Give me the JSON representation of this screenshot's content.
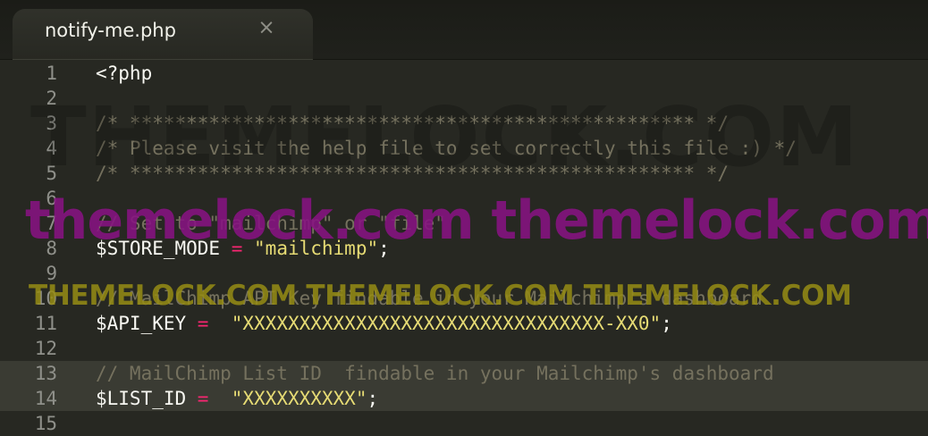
{
  "tab": {
    "title": "notify-me.php",
    "close_glyph": "×"
  },
  "lines": [
    {
      "num": "1",
      "tokens": [
        {
          "t": "<?php",
          "c": "pl"
        }
      ]
    },
    {
      "num": "2",
      "tokens": []
    },
    {
      "num": "3",
      "tokens": [
        {
          "t": "/* ************************************************** */",
          "c": "cm"
        }
      ]
    },
    {
      "num": "4",
      "tokens": [
        {
          "t": "/* Please visit the help file to set correctly this file :) */",
          "c": "cm"
        }
      ]
    },
    {
      "num": "5",
      "tokens": [
        {
          "t": "/* ************************************************** */",
          "c": "cm"
        }
      ]
    },
    {
      "num": "6",
      "tokens": []
    },
    {
      "num": "7",
      "tokens": [
        {
          "t": "// Set to \"mailchimp\" or \"file\"",
          "c": "cm"
        }
      ]
    },
    {
      "num": "8",
      "tokens": [
        {
          "t": "$STORE_MODE ",
          "c": "pl"
        },
        {
          "t": "=",
          "c": "op"
        },
        {
          "t": " ",
          "c": "pl"
        },
        {
          "t": "\"mailchimp\"",
          "c": "st"
        },
        {
          "t": ";",
          "c": "pl"
        }
      ]
    },
    {
      "num": "9",
      "tokens": []
    },
    {
      "num": "10",
      "tokens": [
        {
          "t": "// MailChimp API Key findable in your Mailchimp's dashboard",
          "c": "cm"
        }
      ]
    },
    {
      "num": "11",
      "tokens": [
        {
          "t": "$API_KEY ",
          "c": "pl"
        },
        {
          "t": "=",
          "c": "op"
        },
        {
          "t": "  ",
          "c": "pl"
        },
        {
          "t": "\"XXXXXXXXXXXXXXXXXXXXXXXXXXXXXXXX-XX0\"",
          "c": "st"
        },
        {
          "t": ";",
          "c": "pl"
        }
      ]
    },
    {
      "num": "12",
      "tokens": []
    },
    {
      "num": "13",
      "tokens": [
        {
          "t": "// MailChimp List ID  findable in your Mailchimp's dashboard",
          "c": "cm"
        }
      ],
      "active": true
    },
    {
      "num": "14",
      "tokens": [
        {
          "t": "$LIST_ID ",
          "c": "pl"
        },
        {
          "t": "=",
          "c": "op"
        },
        {
          "t": "  ",
          "c": "pl"
        },
        {
          "t": "\"XXXXXXXXXX\"",
          "c": "st"
        },
        {
          "t": ";",
          "c": "pl"
        }
      ],
      "active": true
    },
    {
      "num": "15",
      "tokens": []
    }
  ],
  "watermarks": {
    "gray": "THEMELOCK.COM",
    "purple": "themelock.com themelock.com",
    "olive": "THEMELOCK.COM THEMELOCK.COM THEMELOCK.COM"
  },
  "colors": {
    "background": "#272822",
    "comment": "#75715e",
    "operator": "#f92672",
    "string": "#e6db74",
    "plain": "#f8f8f2",
    "line_number": "#8f908a"
  }
}
